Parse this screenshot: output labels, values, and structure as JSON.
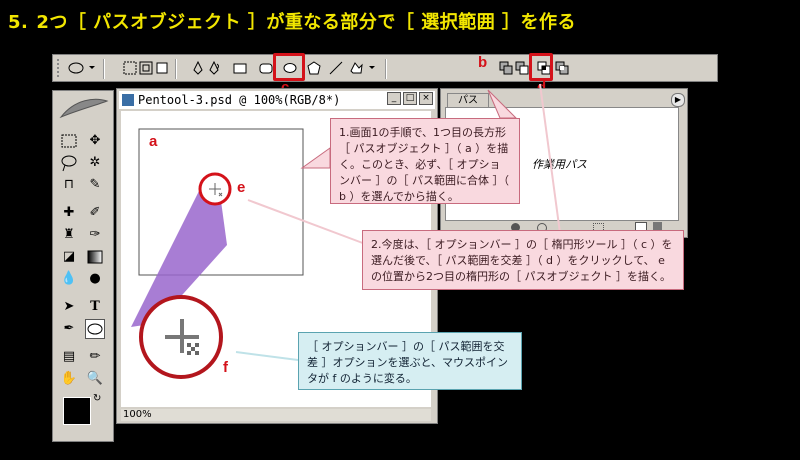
{
  "heading": {
    "number": "5.",
    "text": "2つ［ パスオブジェクト ］が重なる部分で［ 選択範囲 ］を作る"
  },
  "markers": {
    "a": "a",
    "b": "b",
    "c": "c",
    "d": "d",
    "e": "e",
    "f": "f"
  },
  "document": {
    "title": "Pentool-3.psd @ 100%(RGB/8*)",
    "zoom": "100%"
  },
  "paths_panel": {
    "tab": "パス",
    "work_path_label": "作業用パス"
  },
  "callouts": {
    "step1": "1.画面1の手順で、1つ目の長方形［ パスオブジェクト ］（ a ）を描く。このとき、必ず、［ オプションバー ］の［ パス範囲に合体 ］（ b ）を選んでから描く。",
    "step2": "2.今度は、［ オプションバー ］の［ 楕円形ツール ］（ c ）を選んだ後で、［ パス範囲を交差 ］（ d ）をクリックして、 e の位置から2つ目の楕円形の［ パスオブジェクト ］を描く。",
    "note": "［ オプションバー ］の［ パス範囲を交差 ］オプションを選ぶと、マウスポインタが f のように変る。"
  },
  "colors": {
    "accent_red": "#d4121a",
    "title_yellow": "#f2e600",
    "lavender": "#9966cc"
  }
}
